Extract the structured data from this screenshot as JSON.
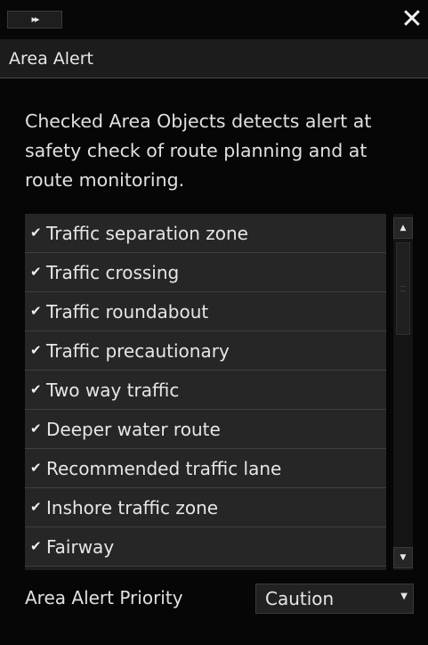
{
  "toolbar": {
    "expand_label": "▸▸",
    "close_label": "✕"
  },
  "header": {
    "title": "Area Alert"
  },
  "description": "Checked Area Objects detects alert at safety check of route planning and at route monitoring.",
  "area_objects": {
    "items": [
      {
        "label": "Traffic separation zone",
        "checked": true
      },
      {
        "label": "Traffic crossing",
        "checked": true
      },
      {
        "label": "Traffic roundabout",
        "checked": true
      },
      {
        "label": "Traffic precautionary",
        "checked": true
      },
      {
        "label": "Two way traffic",
        "checked": true
      },
      {
        "label": "Deeper water route",
        "checked": true
      },
      {
        "label": "Recommended traffic lane",
        "checked": true
      },
      {
        "label": "Inshore traffic zone",
        "checked": true
      },
      {
        "label": "Fairway",
        "checked": true
      }
    ],
    "check_glyph": "✔"
  },
  "scrollbar": {
    "up_glyph": "▲",
    "down_glyph": "▼"
  },
  "priority": {
    "label": "Area Alert Priority",
    "value": "Caution",
    "arrow_glyph": "▼"
  }
}
